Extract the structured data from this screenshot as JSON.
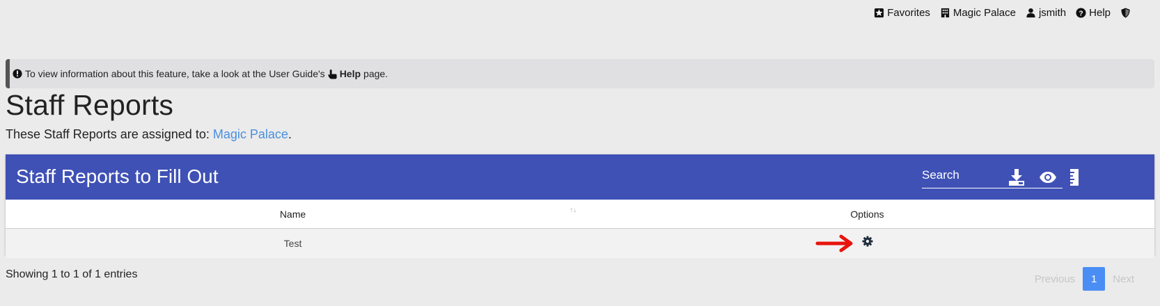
{
  "topnav": {
    "favorites": "Favorites",
    "location": "Magic Palace",
    "user": "jsmith",
    "help": "Help"
  },
  "notice": {
    "prefix": "To view information about this feature, take a look at the User Guide's",
    "link": "Help",
    "suffix": "page."
  },
  "page": {
    "title": "Staff Reports",
    "assigned_prefix": "These Staff Reports are assigned to:",
    "assigned_link": "Magic Palace",
    "assigned_suffix": "."
  },
  "card": {
    "title": "Staff Reports to Fill Out",
    "search_placeholder": "Search",
    "columns": [
      "Name",
      "Options"
    ],
    "rows": [
      {
        "name": "Test"
      }
    ]
  },
  "footer": {
    "entries": "Showing 1 to 1 of 1 entries",
    "previous": "Previous",
    "current_page": "1",
    "next": "Next"
  },
  "colors": {
    "header_bg": "#3f51b5",
    "link": "#4a8fdd",
    "active_page": "#4a8df5",
    "arrow": "#e8140e"
  }
}
